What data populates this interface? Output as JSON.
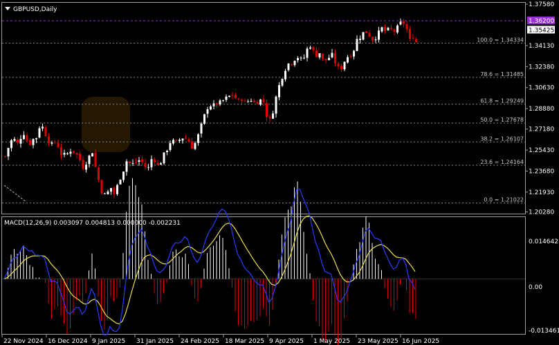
{
  "title": "GBPUSD,Daily",
  "macd_title": "MACD(12,26,9) 0.003097 0.004813 0.000000 -0.002231",
  "colors": {
    "background": "#000000",
    "bull_candle": "#ffffff",
    "bear_candle": "#e00000",
    "grid_dotted": "#8a8a8a",
    "ask_line": "#9b30d9",
    "macd_line": "#2a3cff",
    "signal_line": "#f0e040",
    "hist_pos": "#ffffff",
    "hist_neg": "#e00000"
  },
  "chart_data": [
    {
      "type": "candlestick",
      "title": "GBPUSD,Daily",
      "ylim": [
        1.2031,
        1.3758
      ],
      "y_ticks": [
        "1.37580",
        "1.34130",
        "1.32380",
        "1.30630",
        "1.28880",
        "1.27180",
        "1.25430",
        "1.23680",
        "1.21930",
        "1.20280"
      ],
      "x_ticks": [
        "22 Nov 2024",
        "16 Dec 2024",
        "9 Jan 2025",
        "31 Jan 2025",
        "24 Feb 2025",
        "18 Mar 2025",
        "9 Apr 2025",
        "1 May 2025",
        "23 May 2025",
        "16 Jun 2025"
      ],
      "current_price": "1.35425",
      "ask_price": "1.36200",
      "fibonacci": [
        {
          "level": "100.0",
          "value": "1.34334"
        },
        {
          "level": "78.6",
          "value": "1.31485"
        },
        {
          "level": "61.8",
          "value": "1.29249"
        },
        {
          "level": "50.0",
          "value": "1.27678"
        },
        {
          "level": "38.2",
          "value": "1.26107"
        },
        {
          "level": "23.6",
          "value": "1.24164"
        },
        {
          "level": "0.0",
          "value": "1.21022"
        }
      ],
      "close_path": [
        [
          0,
          1.249
        ],
        [
          8,
          1.262
        ],
        [
          14,
          1.263
        ],
        [
          20,
          1.258
        ],
        [
          24,
          1.269
        ],
        [
          28,
          1.268
        ],
        [
          34,
          1.258
        ],
        [
          40,
          1.264
        ],
        [
          43,
          1.26
        ],
        [
          48,
          1.272
        ],
        [
          52,
          1.276
        ],
        [
          58,
          1.268
        ],
        [
          66,
          1.258
        ],
        [
          74,
          1.262
        ],
        [
          80,
          1.251
        ],
        [
          88,
          1.25
        ],
        [
          96,
          1.255
        ],
        [
          104,
          1.25
        ],
        [
          108,
          1.246
        ],
        [
          114,
          1.238
        ],
        [
          118,
          1.246
        ],
        [
          126,
          1.253
        ],
        [
          132,
          1.236
        ],
        [
          140,
          1.219
        ],
        [
          146,
          1.216
        ],
        [
          152,
          1.224
        ],
        [
          158,
          1.217
        ],
        [
          164,
          1.228
        ],
        [
          170,
          1.236
        ],
        [
          176,
          1.246
        ],
        [
          182,
          1.242
        ],
        [
          188,
          1.244
        ],
        [
          194,
          1.246
        ],
        [
          200,
          1.243
        ],
        [
          206,
          1.237
        ],
        [
          210,
          1.247
        ],
        [
          216,
          1.246
        ],
        [
          222,
          1.24
        ],
        [
          228,
          1.249
        ],
        [
          234,
          1.255
        ],
        [
          240,
          1.263
        ],
        [
          246,
          1.26
        ],
        [
          252,
          1.263
        ],
        [
          258,
          1.265
        ],
        [
          264,
          1.263
        ],
        [
          270,
          1.257
        ],
        [
          276,
          1.261
        ],
        [
          282,
          1.272
        ],
        [
          288,
          1.283
        ],
        [
          294,
          1.292
        ],
        [
          300,
          1.291
        ],
        [
          306,
          1.293
        ],
        [
          312,
          1.294
        ],
        [
          318,
          1.297
        ],
        [
          324,
          1.299
        ],
        [
          330,
          1.301
        ],
        [
          336,
          1.294
        ],
        [
          342,
          1.297
        ],
        [
          348,
          1.293
        ],
        [
          354,
          1.297
        ],
        [
          360,
          1.294
        ],
        [
          366,
          1.295
        ],
        [
          372,
          1.297
        ],
        [
          376,
          1.29
        ],
        [
          380,
          1.276
        ],
        [
          386,
          1.284
        ],
        [
          390,
          1.295
        ],
        [
          396,
          1.308
        ],
        [
          402,
          1.318
        ],
        [
          408,
          1.326
        ],
        [
          414,
          1.327
        ],
        [
          418,
          1.33
        ],
        [
          424,
          1.332
        ],
        [
          430,
          1.328
        ],
        [
          436,
          1.338
        ],
        [
          442,
          1.342
        ],
        [
          448,
          1.332
        ],
        [
          454,
          1.336
        ],
        [
          460,
          1.328
        ],
        [
          466,
          1.33
        ],
        [
          472,
          1.334
        ],
        [
          478,
          1.326
        ],
        [
          484,
          1.32
        ],
        [
          490,
          1.328
        ],
        [
          496,
          1.333
        ],
        [
          502,
          1.334
        ],
        [
          508,
          1.346
        ],
        [
          514,
          1.349
        ],
        [
          520,
          1.354
        ],
        [
          526,
          1.35
        ],
        [
          532,
          1.346
        ],
        [
          538,
          1.35
        ],
        [
          544,
          1.356
        ],
        [
          550,
          1.353
        ],
        [
          556,
          1.355
        ],
        [
          562,
          1.353
        ],
        [
          568,
          1.357
        ],
        [
          574,
          1.362
        ],
        [
          580,
          1.356
        ],
        [
          584,
          1.345
        ],
        [
          590,
          1.349
        ],
        [
          596,
          1.342
        ],
        [
          602,
          1.356
        ],
        [
          606,
          1.354
        ]
      ]
    },
    {
      "type": "macd",
      "title": "MACD(12,26,9)",
      "values": {
        "main": "0.003097",
        "signal": "0.004813",
        "third": "0.000000",
        "histogram": "-0.002231"
      },
      "y_ticks": [
        "0.014642",
        "0.00",
        "-0.013461"
      ],
      "ylim": [
        -0.014,
        0.0152
      ]
    }
  ]
}
